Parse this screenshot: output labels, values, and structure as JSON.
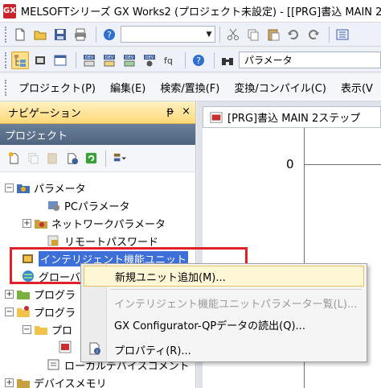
{
  "window": {
    "title": "MELSOFTシリーズ GX Works2 (プロジェクト未設定) - [[PRG]書込 MAIN 2",
    "app_icon_text": "GX"
  },
  "toolbar2": {
    "parameter_field": "パラメータ"
  },
  "menubar": {
    "items": [
      "プロジェクト(P)",
      "編集(E)",
      "検索/置換(F)",
      "変換/コンパイル(C)",
      "表示(V"
    ]
  },
  "navigation": {
    "header": "ナビゲーション",
    "pin_glyph": "ᵽ",
    "close_glyph": "×",
    "section": "プロジェクト"
  },
  "tree": {
    "parameter": "パラメータ",
    "pc_parameter": "PCパラメータ",
    "network_parameter": "ネットワークパラメータ",
    "remote_password": "リモートパスワード",
    "intelligent_unit": "インテリジェント機能ユニット",
    "global": "グローバ",
    "program1": "プログラ",
    "program2": "プログラ",
    "program_sub": "プロ",
    "local_device_comment": "ローカルデバイスコメント",
    "device_memory": "デバイスメモリ"
  },
  "context_menu": {
    "items": [
      {
        "label": "新規ユニット追加(M)...",
        "state": "hover"
      },
      {
        "label": "インテリジェント機能ユニットパラメーター覧(L)...",
        "state": "disabled"
      },
      {
        "label": "GX Configurator-QPデータの読出(Q)...",
        "state": "normal"
      },
      {
        "label": "プロパティ(R)...",
        "state": "normal"
      }
    ]
  },
  "editor": {
    "tab_title": "[PRG]書込 MAIN 2ステップ",
    "step_number": "0"
  },
  "colors": {
    "nav_header": "#ffd978",
    "project_header": "#56708e",
    "highlight": "#3d6fd8",
    "annotation_box": "#e0202a",
    "menu_hover": "#fff6d6"
  }
}
